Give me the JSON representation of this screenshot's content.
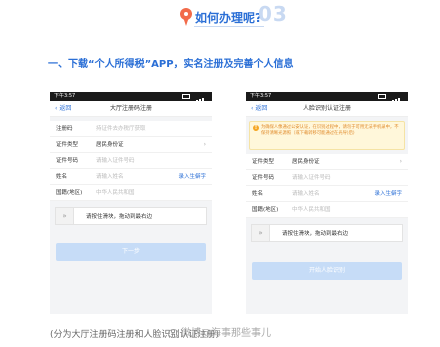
{
  "header": {
    "title": "如何办理呢?",
    "number": "03"
  },
  "subtitle": "一、下载“个人所得税”APP，实名注册及完善个人信息",
  "left_phone": {
    "status_time": "下午3:57",
    "back_label": "返回",
    "nav_title": "大厅注册码注册",
    "rows": [
      {
        "label": "注册码",
        "value": "持证件去办税厅获取",
        "filled": false,
        "action": ""
      },
      {
        "label": "证件类型",
        "value": "居民身份证",
        "filled": true,
        "action": "›"
      },
      {
        "label": "证件号码",
        "value": "请输入证件号码",
        "filled": false,
        "action": ""
      },
      {
        "label": "姓名",
        "value": "请输入姓名",
        "filled": false,
        "action": "录入生僻字"
      },
      {
        "label": "国籍(地区)",
        "value": "中华人民共和国",
        "filled": false,
        "action": ""
      }
    ],
    "slider_text": "请按住滑块，拖动到最右边",
    "button_label": "下一步"
  },
  "right_phone": {
    "status_time": "下午3:57",
    "back_label": "返回",
    "nav_title": "人脸识别认证注册",
    "notice": "为确保人像通过公安认证，在识别过程中，请勿于可用无法手机录中，不保持清晰光源照（或下载转移可能通过在光导)后)",
    "rows": [
      {
        "label": "证件类型",
        "value": "居民身份证",
        "filled": true,
        "action": "›"
      },
      {
        "label": "证件号码",
        "value": "请输入证件号码",
        "filled": false,
        "action": ""
      },
      {
        "label": "姓名",
        "value": "请输入姓名",
        "filled": false,
        "action": "录入生僻字"
      },
      {
        "label": "国籍(地区)",
        "value": "中华人民共和国",
        "filled": false,
        "action": ""
      }
    ],
    "slider_text": "请按住滑块，拖动到最右边",
    "button_label": "开始人脸识别"
  },
  "caption": "(分为大厅注册码注册和人脸识别认证注册)",
  "watermark": "微博@海事那些事儿",
  "colors": {
    "accent": "#2b6fd6",
    "pin": "#f26b4a",
    "button_disabled": "#c6dcf7",
    "notice_bg": "#fff7da"
  }
}
